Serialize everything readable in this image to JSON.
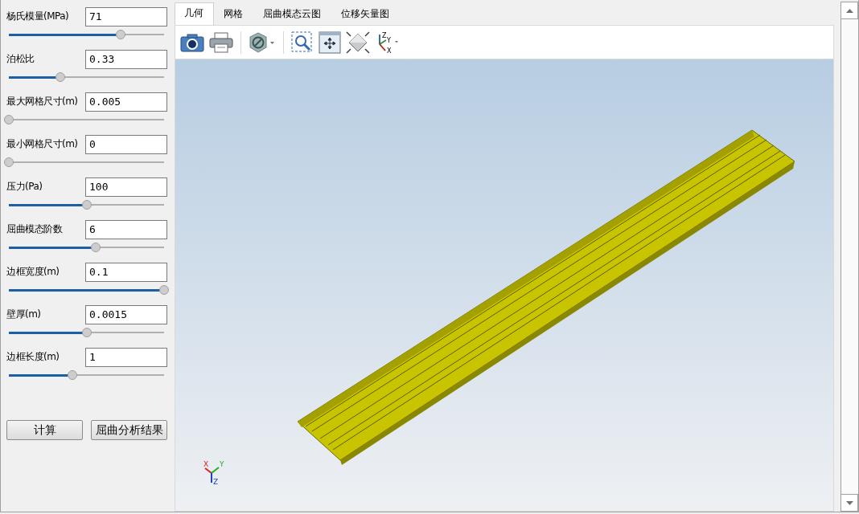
{
  "params": [
    {
      "label": "杨氏模量(MPa)",
      "value": "71",
      "level": 0.72
    },
    {
      "label": "泊松比",
      "value": "0.33",
      "level": 0.33
    },
    {
      "label": "最大网格尺寸(m)",
      "value": "0.005",
      "level": 0
    },
    {
      "label": "最小网格尺寸(m)",
      "value": "0",
      "level": 0
    },
    {
      "label": "压力(Pa)",
      "value": "100",
      "level": 0.5
    },
    {
      "label": "屈曲模态阶数",
      "value": "6",
      "level": 0.56
    },
    {
      "label": "边框宽度(m)",
      "value": "0.1",
      "level": 1
    },
    {
      "label": "壁厚(m)",
      "value": "0.0015",
      "level": 0.5
    },
    {
      "label": "边框长度(m)",
      "value": "1",
      "level": 0.41
    }
  ],
  "buttons": [
    "计算",
    "屈曲分析结果"
  ],
  "tabs": [
    {
      "label": "几何",
      "selected": true
    },
    {
      "label": "网格",
      "selected": false
    },
    {
      "label": "屈曲模态云图",
      "selected": false
    },
    {
      "label": "位移矢量图",
      "selected": false
    }
  ],
  "toolbar": [
    {
      "kind": "camera"
    },
    {
      "kind": "printer"
    },
    {
      "kind": "separator"
    },
    {
      "kind": "hexagon"
    },
    {
      "kind": "separator"
    },
    {
      "kind": "zoom-box"
    },
    {
      "kind": "fit"
    },
    {
      "kind": "diamond"
    },
    {
      "kind": "axes",
      "labels": [
        "Z",
        "Y",
        "X"
      ]
    }
  ],
  "triad": {
    "x": "X",
    "y": "Y",
    "z": "Z"
  }
}
